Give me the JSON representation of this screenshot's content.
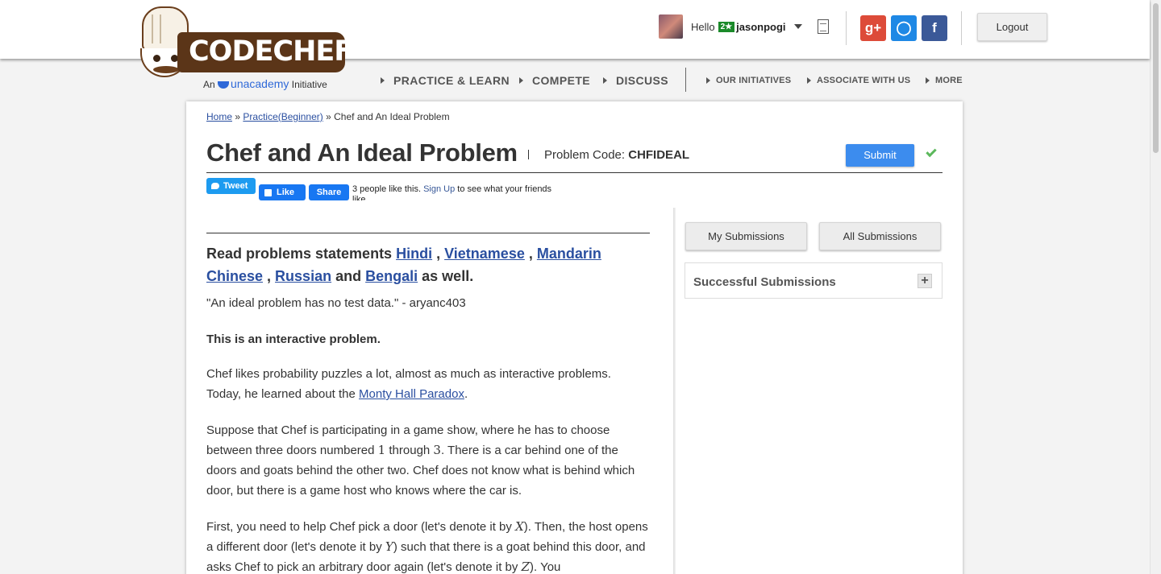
{
  "header": {
    "brand": "CODECHEF",
    "tagline_prefix": "An",
    "tagline_org": "unacademy",
    "tagline_suffix": "Initiative",
    "greeting": "Hello",
    "rating_badge": "2★",
    "username": "jasonpogi",
    "logout_label": "Logout",
    "social": [
      {
        "name": "google-plus",
        "glyph": "g+",
        "color": "#dd4b39"
      },
      {
        "name": "github",
        "glyph": "◯",
        "color": "#1e88e5"
      },
      {
        "name": "facebook",
        "glyph": "f",
        "color": "#3b5998"
      }
    ]
  },
  "nav": {
    "main": [
      "PRACTICE & LEARN",
      "COMPETE",
      "DISCUSS"
    ],
    "secondary": [
      "OUR INITIATIVES",
      "ASSOCIATE WITH US",
      "MORE"
    ]
  },
  "breadcrumb": {
    "home": "Home",
    "sep": "»",
    "practice": "Practice(Beginner)",
    "current": "Chef and An Ideal Problem"
  },
  "problem": {
    "title": "Chef and An Ideal Problem",
    "code_label": "Problem Code:",
    "code": "CHFIDEAL",
    "submit_label": "Submit"
  },
  "share": {
    "tweet": "Tweet",
    "like": "Like",
    "share": "Share",
    "fb_text_pre": "3 people like this.",
    "fb_signup": "Sign Up",
    "fb_text_post": "to see what your friends like."
  },
  "statement": {
    "lang_prefix": "Read problems statements",
    "lang_links": [
      "Hindi",
      "Vietnamese",
      "Mandarin Chinese",
      "Russian",
      "Bengali"
    ],
    "lang_and": "and",
    "lang_suffix": "as well.",
    "quote": "\"An ideal problem has no test data.\" - aryanc403",
    "interactive": "This is an interactive problem.",
    "p1_pre": "Chef likes probability puzzles a lot, almost as much as interactive problems. Today, he learned about the",
    "p1_link": "Monty Hall Paradox",
    "p1_post": ".",
    "p2_a": "Suppose that Chef is participating in a game show, where he has to choose between three doors numbered",
    "p2_n1": "1",
    "p2_b": "through",
    "p2_n2": "3",
    "p2_c": ". There is a car behind one of the doors and goats behind the other two. Chef does not know what is behind which door, but there is a game host who knows where the car is.",
    "p3_a": "First, you need to help Chef pick a door (let's denote it by",
    "p3_x": "X",
    "p3_b": "). Then, the host opens a different door (let's denote it by",
    "p3_y": "Y",
    "p3_c": ") such that there is a goat behind this door, and asks Chef to pick an arbitrary door again (let's denote it by",
    "p3_z": "Z",
    "p3_d": "). You"
  },
  "sidebar": {
    "my_submissions": "My Submissions",
    "all_submissions": "All Submissions",
    "successful": "Successful Submissions",
    "expand": "+"
  }
}
